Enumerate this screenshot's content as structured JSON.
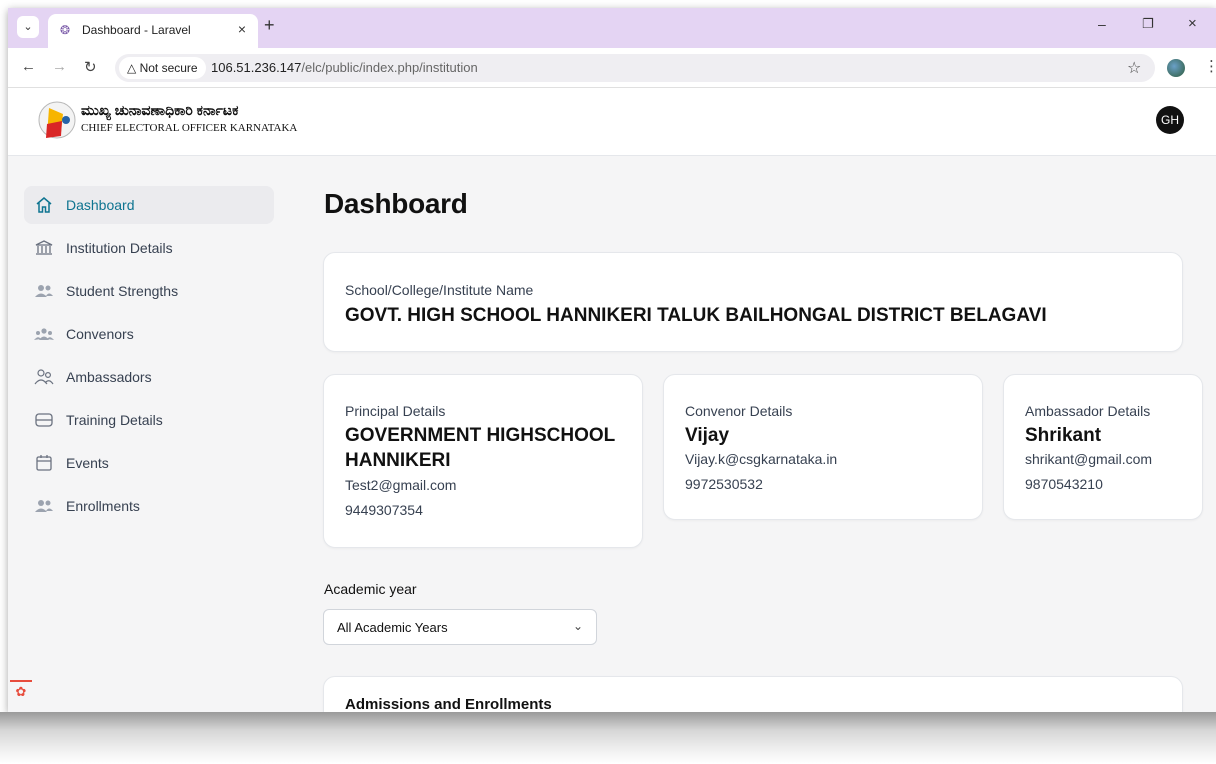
{
  "browser": {
    "tab_menu_icon": "chevron-down-icon",
    "tab_title": "Dashboard - Laravel",
    "new_tab_symbol": "+",
    "security_label": "Not secure",
    "url_host": "106.51.236.147",
    "url_path": "/elc/public/index.php/institution"
  },
  "header": {
    "org_name_kannada": "ಮುಖ್ಯ ಚುನಾವಣಾಧಿಕಾರಿ ಕರ್ನಾಟಕ",
    "org_name_english": "CHIEF ELECTORAL OFFICER KARNATAKA",
    "avatar_initials": "GH"
  },
  "sidebar": {
    "active_color": "#0e7490",
    "items": [
      {
        "label": "Dashboard",
        "icon": "home-icon"
      },
      {
        "label": "Institution Details",
        "icon": "institution-icon"
      },
      {
        "label": "Student Strengths",
        "icon": "users-icon"
      },
      {
        "label": "Convenors",
        "icon": "user-group-icon"
      },
      {
        "label": "Ambassadors",
        "icon": "users-outline-icon"
      },
      {
        "label": "Training Details",
        "icon": "inbox-stack-icon"
      },
      {
        "label": "Events",
        "icon": "calendar-icon"
      },
      {
        "label": "Enrollments",
        "icon": "users-icon"
      }
    ]
  },
  "main": {
    "title": "Dashboard",
    "school": {
      "label": "School/College/Institute Name",
      "name": "GOVT. HIGH SCHOOL HANNIKERI TALUK BAILHONGAL DISTRICT BELAGAVI"
    },
    "principal": {
      "label": "Principal Details",
      "name_line1": "GOVERNMENT HIGHSCHOOL",
      "name_line2": "HANNIKERI",
      "email": "Test2@gmail.com",
      "phone": "9449307354"
    },
    "convenor": {
      "label": "Convenor Details",
      "name": "Vijay",
      "email": "Vijay.k@csgkarnataka.in",
      "phone": "9972530532"
    },
    "ambassador": {
      "label": "Ambassador Details",
      "name": "Shrikant",
      "email": "shrikant@gmail.com",
      "phone": "9870543210"
    },
    "academic_year": {
      "label": "Academic year",
      "selected": "All Academic Years"
    },
    "admissions": {
      "title": "Admissions and Enrollments"
    }
  }
}
